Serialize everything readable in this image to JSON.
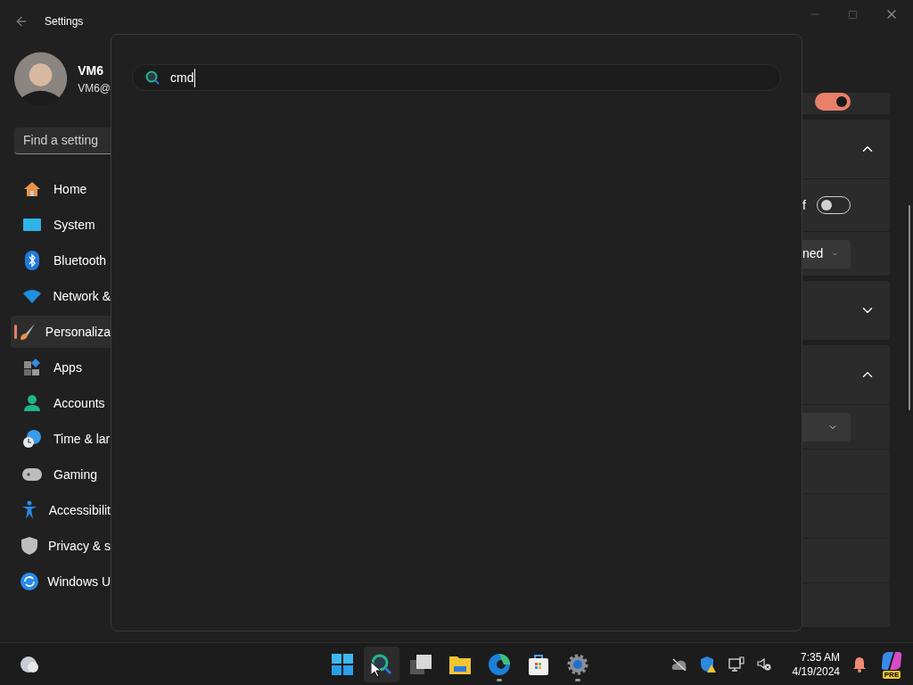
{
  "window": {
    "title": "Settings"
  },
  "user": {
    "name": "VM6",
    "email": "VM6@"
  },
  "find_setting": {
    "placeholder": "Find a setting"
  },
  "nav": [
    {
      "label": "Home",
      "selected": false
    },
    {
      "label": "System",
      "selected": false
    },
    {
      "label": "Bluetooth",
      "selected": false
    },
    {
      "label": "Network &",
      "selected": false
    },
    {
      "label": "Personaliza",
      "selected": true
    },
    {
      "label": "Apps",
      "selected": false
    },
    {
      "label": "Accounts",
      "selected": false
    },
    {
      "label": "Time & lar",
      "selected": false
    },
    {
      "label": "Gaming",
      "selected": false
    },
    {
      "label": "Accessibilit",
      "selected": false
    },
    {
      "label": "Privacy & s",
      "selected": false
    },
    {
      "label": "Windows U",
      "selected": false
    }
  ],
  "search_panel": {
    "query": "cmd"
  },
  "cards": [
    {
      "rows": [
        {
          "kind": "toggle",
          "on": true
        }
      ]
    },
    {
      "rows": [
        {
          "kind": "header",
          "expanded": true
        },
        {
          "kind": "toggle",
          "label": "f",
          "on": false
        },
        {
          "kind": "dropdown",
          "value": "ned"
        }
      ]
    },
    {
      "rows": [
        {
          "kind": "header",
          "expanded": false
        }
      ]
    },
    {
      "rows": [
        {
          "kind": "header",
          "expanded": true
        },
        {
          "kind": "dropdown"
        },
        {
          "kind": "blank"
        },
        {
          "kind": "blank"
        },
        {
          "kind": "blank"
        },
        {
          "kind": "blank"
        }
      ]
    }
  ],
  "taskbar": {
    "apps": [
      {
        "selected": false,
        "running": false
      },
      {
        "selected": true,
        "running": false
      },
      {
        "selected": false,
        "running": false
      },
      {
        "selected": false,
        "running": false
      },
      {
        "selected": false,
        "running": true
      },
      {
        "selected": false,
        "running": false
      },
      {
        "selected": false,
        "running": true
      }
    ],
    "time": "7:35 AM",
    "date": "4/19/2024",
    "copilot_badge": "PRE"
  }
}
